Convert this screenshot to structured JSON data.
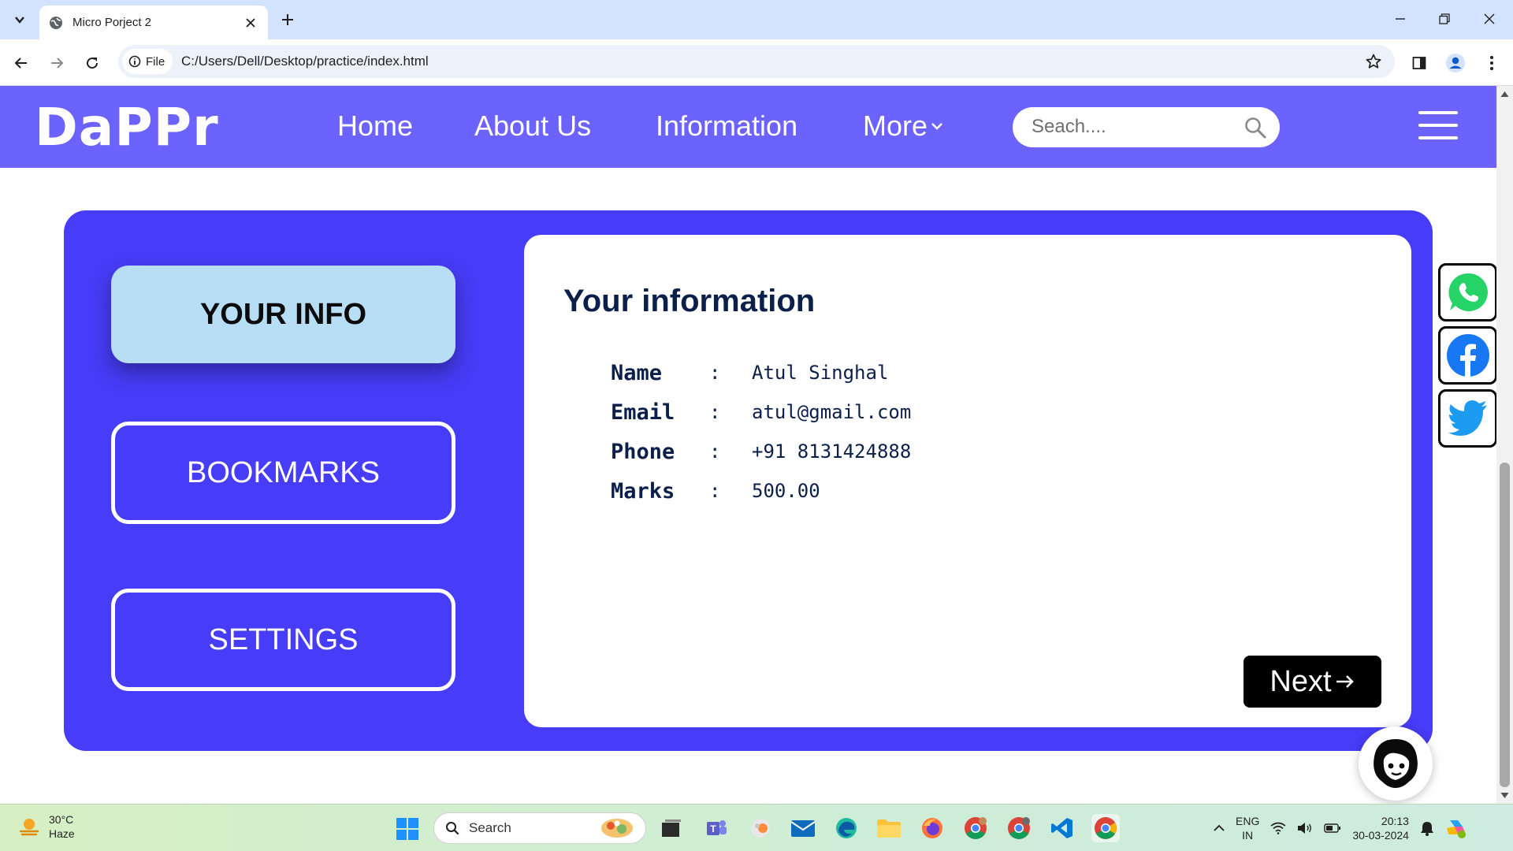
{
  "browser": {
    "tab_title": "Micro Porject 2",
    "site_chip_label": "File",
    "url": "C:/Users/Dell/Desktop/practice/index.html"
  },
  "site": {
    "logo": "DaPPr",
    "nav": {
      "home": "Home",
      "about": "About Us",
      "information": "Information",
      "more": "More"
    },
    "search_placeholder": "Seach....",
    "sidebar": {
      "your_info": "YOUR INFO",
      "bookmarks": "BOOKMARKS",
      "settings": "SETTINGS"
    },
    "info": {
      "title": "Your information",
      "rows": [
        {
          "label": "Name",
          "sep": ":",
          "value": "Atul Singhal"
        },
        {
          "label": "Email",
          "sep": ":",
          "value": "atul@gmail.com"
        },
        {
          "label": "Phone",
          "sep": ":",
          "value": "+91 8131424888"
        },
        {
          "label": "Marks",
          "sep": ":",
          "value": "500.00"
        }
      ],
      "next_label": "Next"
    },
    "social_icons": [
      "whatsapp-icon",
      "facebook-icon",
      "twitter-icon"
    ],
    "colors": {
      "nav_bg": "#6c63ff",
      "panel_bg": "#473cf7",
      "active_btn_bg": "#b8def6",
      "text_dark": "#0a1f4a"
    }
  },
  "taskbar": {
    "weather_temp": "30°C",
    "weather_desc": "Haze",
    "search_label": "Search",
    "lang_primary": "ENG",
    "lang_region": "IN",
    "time": "20:13",
    "date": "30-03-2024"
  }
}
